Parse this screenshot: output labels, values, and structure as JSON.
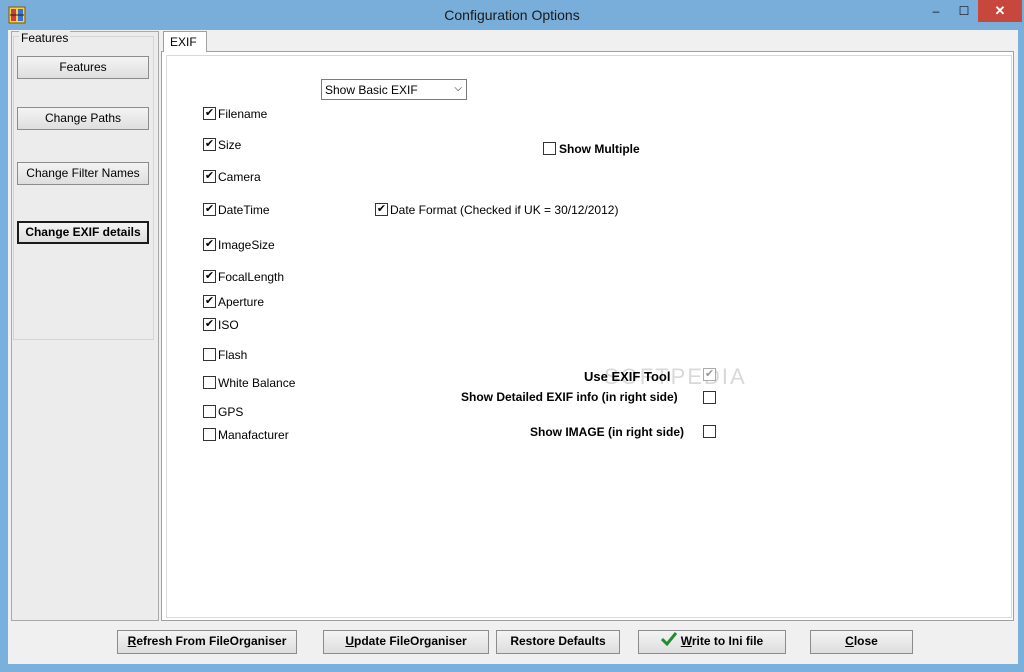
{
  "window": {
    "title": "Configuration Options",
    "min_glyph": "–",
    "max_glyph": "☐",
    "close_glyph": "✕"
  },
  "features": {
    "group_label": "Features",
    "buttons": [
      "Features",
      "Change Paths",
      "Change Filter Names",
      "Change EXIF details"
    ]
  },
  "tab": {
    "label": "EXIF"
  },
  "exif_mode": {
    "selected": "Show Basic EXIF",
    "arrow": "⌵"
  },
  "fields": [
    {
      "label": "Filename",
      "checked": true
    },
    {
      "label": "Size",
      "checked": true
    },
    {
      "label": "Camera",
      "checked": true
    },
    {
      "label": "DateTime",
      "checked": true
    },
    {
      "label": "ImageSize",
      "checked": true
    },
    {
      "label": "FocalLength",
      "checked": true
    },
    {
      "label": "Aperture",
      "checked": true
    },
    {
      "label": "ISO",
      "checked": true
    },
    {
      "label": "Flash",
      "checked": false
    },
    {
      "label": "White Balance",
      "checked": false
    },
    {
      "label": "GPS",
      "checked": false
    },
    {
      "label": "Manafacturer",
      "checked": false
    }
  ],
  "options": {
    "show_multiple": {
      "label": "Show Multiple",
      "checked": false
    },
    "date_format": {
      "label": "Date Format (Checked if UK = 30/12/2012)",
      "checked": true
    },
    "use_exif_tool": {
      "label": "Use EXIF Tool",
      "checked": true
    },
    "show_detailed": {
      "label": "Show Detailed EXIF info (in right side)",
      "checked": false
    },
    "show_image": {
      "label": "Show IMAGE (in right side)",
      "checked": false
    }
  },
  "bottom_buttons": {
    "refresh": {
      "mnemonic": "R",
      "rest": "efresh From FileOrganiser"
    },
    "update": {
      "mnemonic": "U",
      "rest": "pdate FileOrganiser"
    },
    "restore": {
      "mnemonic": "",
      "rest": "Restore Defaults"
    },
    "write": {
      "mnemonic": "W",
      "rest": "rite to Ini file"
    },
    "close": {
      "mnemonic": "C",
      "rest": "lose"
    }
  },
  "check_glyph": "✔",
  "watermark": "SOFTPEDIA"
}
